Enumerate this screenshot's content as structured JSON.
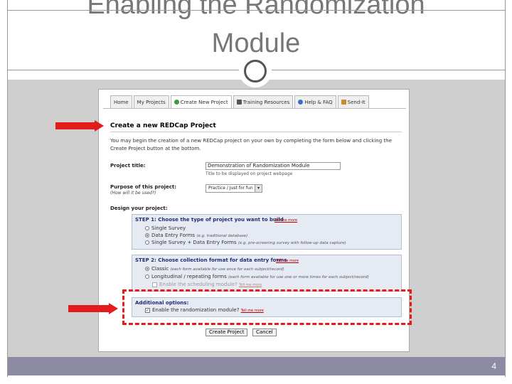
{
  "slide": {
    "title_line1": "Enabling the Randomization",
    "title_line2": "Module",
    "page_number": "4"
  },
  "app": {
    "tabs": [
      {
        "label": "Home",
        "icon": ""
      },
      {
        "label": "My Projects",
        "icon": ""
      },
      {
        "label": "Create New Project",
        "icon": "plus-icon"
      },
      {
        "label": "Training Resources",
        "icon": "video-icon"
      },
      {
        "label": "Help & FAQ",
        "icon": "help-icon"
      },
      {
        "label": "Send-It",
        "icon": "send-icon"
      }
    ],
    "section_title": "Create a new REDCap Project",
    "intro_text": "You may begin the creation of a new REDCap project on your own by completing the form below and clicking the Create Project button at the bottom.",
    "project_title_label": "Project title:",
    "project_title_value": "Demonstration of Randomization Module",
    "project_title_hint": "Title to be displayed on project webpage",
    "purpose_label": "Purpose of this project:",
    "purpose_sub": "(How will it be used?)",
    "purpose_value": "Practice / Just for fun",
    "design_label": "Design your project:",
    "step1": {
      "title": "STEP 1: Choose the type of project you want to build",
      "tell_more": "Tell me more",
      "options": [
        {
          "label": "Single Survey",
          "example": "",
          "selected": false
        },
        {
          "label": "Data Entry Forms",
          "example": "(e.g. traditional database)",
          "selected": true
        },
        {
          "label": "Single Survey + Data Entry Forms",
          "example": "(e.g. pre-screening survey with follow-up data capture)",
          "selected": false
        }
      ]
    },
    "step2": {
      "title": "STEP 2: Choose collection format for data entry forms",
      "tell_more": "Tell me more",
      "options": [
        {
          "label": "Classic",
          "example": "(each form available for use once for each subject/record)",
          "selected": true
        },
        {
          "label": "Longitudinal / repeating forms",
          "example": "(each form available for use one or more times for each subject/record)",
          "selected": false
        }
      ],
      "scheduling_label": "Enable the scheduling module?",
      "scheduling_tell": "Tell me more"
    },
    "additional": {
      "title": "Additional options:",
      "randomization_label": "Enable the randomization module?",
      "randomization_checked": true,
      "tell_more": "Tell me more"
    },
    "create_button": "Create Project",
    "cancel_button": "Cancel"
  },
  "colors": {
    "annotation": "#e31b1b",
    "footer": "#8d8aa3",
    "panel": "#cfcfcf"
  }
}
